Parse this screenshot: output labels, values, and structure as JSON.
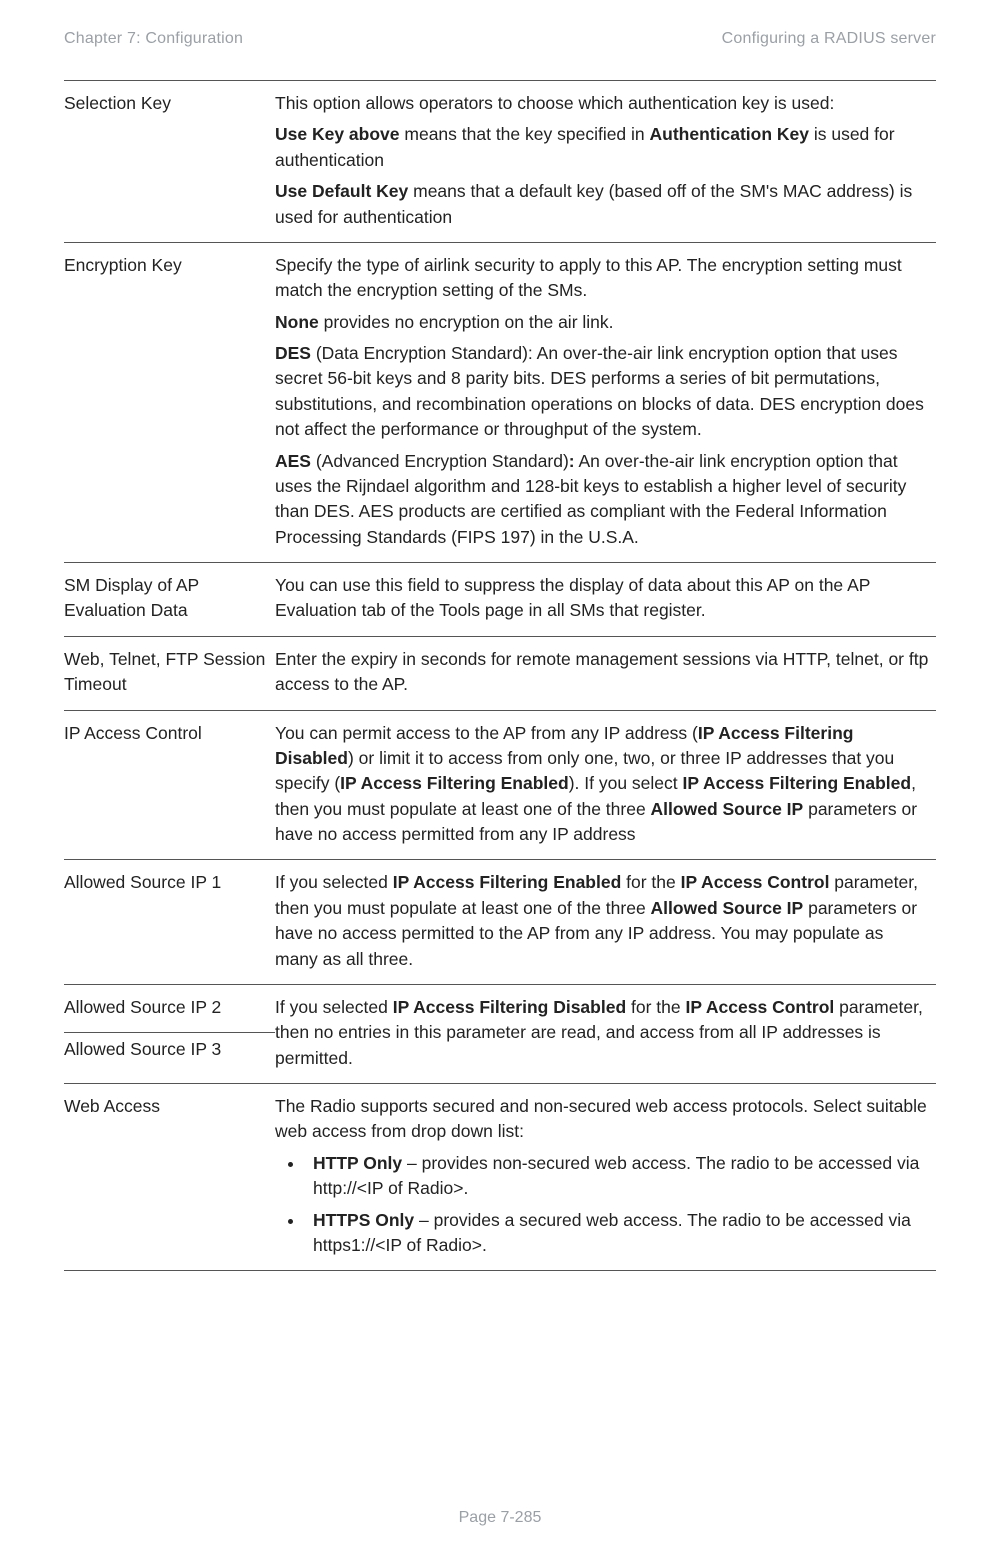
{
  "header": {
    "left": "Chapter 7:  Configuration",
    "right": "Configuring a RADIUS server"
  },
  "footer": "Page 7-285",
  "rows": {
    "selectionKey": {
      "label": "Selection Key",
      "p1": "This option allows operators to choose which authentication key is used:",
      "p2a": "Use Key above",
      "p2b": " means that the key specified in ",
      "p2c": "Authentication Key",
      "p2d": " is used for authentication",
      "p3a": "Use Default Key",
      "p3b": " means that a default key (based off of the SM's MAC address) is used for authentication"
    },
    "encryptionKey": {
      "label": "Encryption Key",
      "p1": "Specify the type of airlink security to apply to this AP. The encryption setting must match the encryption setting of the SMs.",
      "p2a": "None",
      "p2b": " provides no encryption on the air link.",
      "p3a": "DES",
      "p3b": " (Data Encryption Standard): An over-the-air link encryption option that uses secret 56-bit keys and 8 parity bits. DES performs a series of bit permutations, substitutions, and recombination operations on blocks of data. DES encryption does not affect the performance or throughput of the system.",
      "p4a": "AES",
      "p4b": " (Advanced Encryption Standard)",
      "p4c": ":",
      "p4d": " An over-the-air link encryption option that uses the Rijndael algorithm and 128-bit keys to establish a higher level of security than DES. AES products are certified as compliant with the Federal Information Processing Standards (FIPS 197) in the U.S.A."
    },
    "smDisplay": {
      "label": "SM Display of AP Evaluation Data",
      "desc": "You can use this field to suppress the display of data about this AP on the AP Evaluation tab of the Tools page in all SMs that register."
    },
    "sessionTimeout": {
      "label": "Web, Telnet, FTP Session Timeout",
      "desc": "Enter the expiry in seconds for remote management sessions via HTTP, telnet, or ftp access to the AP."
    },
    "ipAccess": {
      "label": "IP Access Control",
      "a": "You can permit access to the AP from any IP address (",
      "b": "IP Access Filtering Disabled",
      "c": ") or limit it to access from only one, two, or three IP addresses that you specify (",
      "d": "IP Access Filtering Enabled",
      "e": "). If you select ",
      "f": "IP Access Filtering Enabled",
      "g": ", then you must populate at least one of the three ",
      "h": "Allowed Source IP",
      "i": " parameters or have no access permitted from any IP address"
    },
    "allowed1": {
      "label": "Allowed Source IP 1",
      "a": "If you selected ",
      "b": "IP Access Filtering Enabled",
      "c": " for the ",
      "d": "IP Access Control",
      "e": " parameter, then you must populate at least one of the three ",
      "f": "Allowed Source IP",
      "g": " parameters or have no access permitted to the AP from any IP address. You may populate as many as all three."
    },
    "allowed2": {
      "label": "Allowed Source IP 2"
    },
    "allowed3": {
      "label": "Allowed Source IP 3"
    },
    "allowedDisabled": {
      "a": "If you selected ",
      "b": "IP Access Filtering Disabled",
      "c": " for the ",
      "d": "IP Access Control",
      "e": " parameter, then no entries in this parameter are read, and access from all IP addresses is permitted."
    },
    "webAccess": {
      "label": "Web Access",
      "intro": "The Radio supports secured and non-secured web access protocols. Select suitable web access from drop down list:",
      "li1a": "HTTP Only",
      "li1b": " – provides non-secured web access. The radio to be accessed via http://<IP of Radio>.",
      "li2a": "HTTPS Only",
      "li2b": " – provides a secured web access. The radio to be accessed via https1://<IP of Radio>."
    }
  }
}
